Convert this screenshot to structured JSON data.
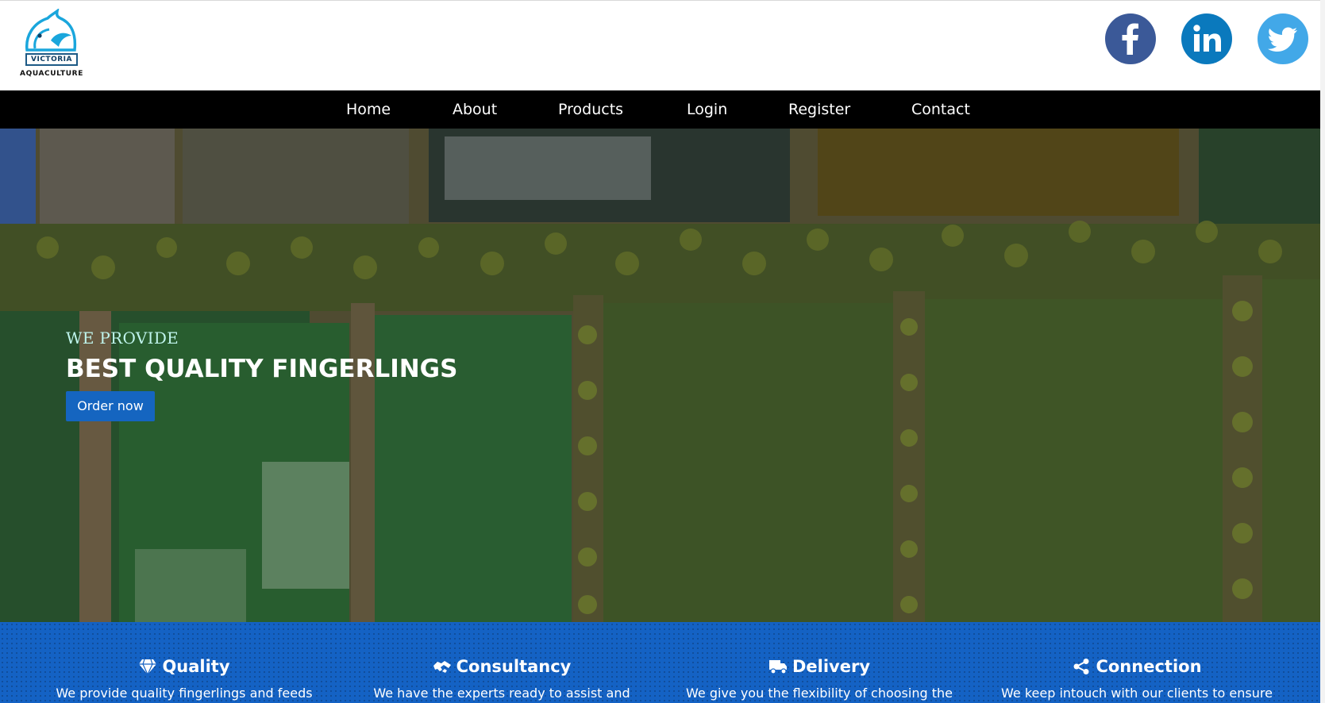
{
  "brand": {
    "logo_line1": "VICTORIA",
    "logo_line2": "AQUACULTURE",
    "logo_icon": "fish-icon"
  },
  "social": [
    {
      "name": "facebook",
      "icon": "facebook-icon",
      "color": "#3b5998"
    },
    {
      "name": "linkedin",
      "icon": "linkedin-icon",
      "color": "#0a79bd"
    },
    {
      "name": "twitter",
      "icon": "twitter-icon",
      "color": "#42a8e8"
    }
  ],
  "nav": {
    "items": [
      "Home",
      "About",
      "Products",
      "Login",
      "Register",
      "Contact"
    ]
  },
  "hero": {
    "eyebrow": "WE PROVIDE",
    "title": "BEST QUALITY FINGERLINGS",
    "button": "Order now",
    "accent": "#1565c0"
  },
  "features": [
    {
      "title": "Quality",
      "icon": "diamond-icon",
      "text": "We provide quality fingerlings and feeds"
    },
    {
      "title": "Consultancy",
      "icon": "handshake-icon",
      "text": "We have the experts ready to assist and"
    },
    {
      "title": "Delivery",
      "icon": "truck-icon",
      "text": "We give you the flexibility of choosing the"
    },
    {
      "title": "Connection",
      "icon": "share-icon",
      "text": "We keep intouch with our clients to ensure"
    }
  ],
  "colors": {
    "nav_bg": "#000000",
    "features_bg": "#1462c4"
  }
}
